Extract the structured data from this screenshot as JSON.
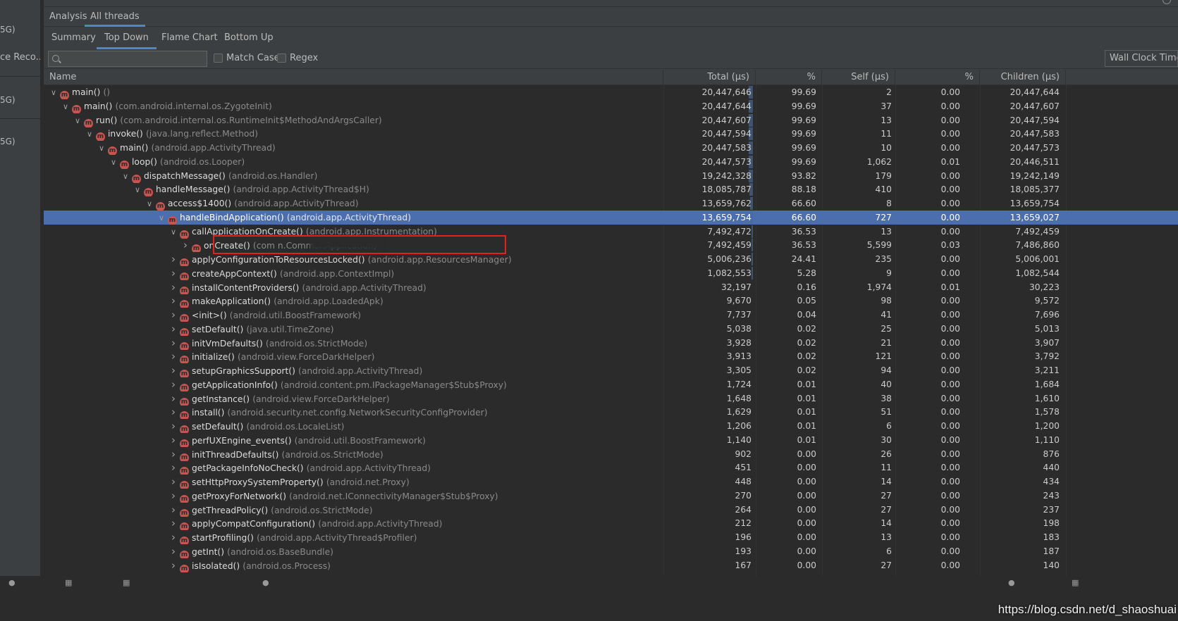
{
  "left_panel": {
    "items": [
      "5G)",
      "ce Reco...",
      "5G)",
      "5G)"
    ]
  },
  "analysis_tabs": [
    "Analysis",
    "All threads"
  ],
  "view_tabs": [
    "Summary",
    "Top Down",
    "Flame Chart",
    "Bottom Up"
  ],
  "search": {
    "placeholder": "",
    "value": ""
  },
  "filters": {
    "match_case": "Match Case",
    "regex": "Regex"
  },
  "clock_select": "Wall Clock Time",
  "columns": [
    "Name",
    "Total (μs)",
    "%",
    "Self (μs)",
    "%",
    "Children (μs)"
  ],
  "rows": [
    {
      "name": "main()",
      "cls": "()",
      "depth": 0,
      "expand": "down",
      "total": "20,447,646",
      "tpct": "99.69",
      "self": "2",
      "spct": "0.00",
      "children": "20,447,644",
      "bar": 0.997
    },
    {
      "name": "main()",
      "cls": "(com.android.internal.os.ZygoteInit)",
      "depth": 1,
      "expand": "down",
      "total": "20,447,644",
      "tpct": "99.69",
      "self": "37",
      "spct": "0.00",
      "children": "20,447,607",
      "bar": 0.997
    },
    {
      "name": "run()",
      "cls": "(com.android.internal.os.RuntimeInit$MethodAndArgsCaller)",
      "depth": 2,
      "expand": "down",
      "total": "20,447,607",
      "tpct": "99.69",
      "self": "13",
      "spct": "0.00",
      "children": "20,447,594",
      "bar": 0.997
    },
    {
      "name": "invoke()",
      "cls": "(java.lang.reflect.Method)",
      "depth": 3,
      "expand": "down",
      "total": "20,447,594",
      "tpct": "99.69",
      "self": "11",
      "spct": "0.00",
      "children": "20,447,583",
      "bar": 0.997
    },
    {
      "name": "main()",
      "cls": "(android.app.ActivityThread)",
      "depth": 4,
      "expand": "down",
      "total": "20,447,583",
      "tpct": "99.69",
      "self": "10",
      "spct": "0.00",
      "children": "20,447,573",
      "bar": 0.997
    },
    {
      "name": "loop()",
      "cls": "(android.os.Looper)",
      "depth": 5,
      "expand": "down",
      "total": "20,447,573",
      "tpct": "99.69",
      "self": "1,062",
      "spct": "0.01",
      "children": "20,446,511",
      "bar": 0.997
    },
    {
      "name": "dispatchMessage()",
      "cls": "(android.os.Handler)",
      "depth": 6,
      "expand": "down",
      "total": "19,242,328",
      "tpct": "93.82",
      "self": "179",
      "spct": "0.00",
      "children": "19,242,149",
      "bar": 0.938
    },
    {
      "name": "handleMessage()",
      "cls": "(android.app.ActivityThread$H)",
      "depth": 7,
      "expand": "down",
      "total": "18,085,787",
      "tpct": "88.18",
      "self": "410",
      "spct": "0.00",
      "children": "18,085,377",
      "bar": 0.882
    },
    {
      "name": "access$1400()",
      "cls": "(android.app.ActivityThread)",
      "depth": 8,
      "expand": "down",
      "total": "13,659,762",
      "tpct": "66.60",
      "self": "8",
      "spct": "0.00",
      "children": "13,659,754",
      "bar": 0.666
    },
    {
      "name": "handleBindApplication()",
      "cls": "(android.app.ActivityThread)",
      "depth": 9,
      "expand": "down",
      "total": "13,659,754",
      "tpct": "66.60",
      "self": "727",
      "spct": "0.00",
      "children": "13,659,027",
      "bar": 0.666,
      "selected": true
    },
    {
      "name": "callApplicationOnCreate()",
      "cls": "(android.app.Instrumentation)",
      "depth": 10,
      "expand": "down",
      "total": "7,492,472",
      "tpct": "36.53",
      "self": "13",
      "spct": "0.00",
      "children": "7,492,459",
      "bar": 0.365
    },
    {
      "name": "onCreate()",
      "cls": "(com                    n.CommonApplication)",
      "depth": 11,
      "expand": "right",
      "total": "7,492,459",
      "tpct": "36.53",
      "self": "5,599",
      "spct": "0.03",
      "children": "7,486,860",
      "bar": 0.365
    },
    {
      "name": "applyConfigurationToResourcesLocked()",
      "cls": "(android.app.ResourcesManager)",
      "depth": 10,
      "expand": "right",
      "total": "5,006,236",
      "tpct": "24.41",
      "self": "235",
      "spct": "0.00",
      "children": "5,006,001",
      "bar": 0.244
    },
    {
      "name": "createAppContext()",
      "cls": "(android.app.ContextImpl)",
      "depth": 10,
      "expand": "right",
      "total": "1,082,553",
      "tpct": "5.28",
      "self": "9",
      "spct": "0.00",
      "children": "1,082,544",
      "bar": 0.053
    },
    {
      "name": "installContentProviders()",
      "cls": "(android.app.ActivityThread)",
      "depth": 10,
      "expand": "right",
      "total": "32,197",
      "tpct": "0.16",
      "self": "1,974",
      "spct": "0.01",
      "children": "30,223",
      "bar": 0
    },
    {
      "name": "makeApplication()",
      "cls": "(android.app.LoadedApk)",
      "depth": 10,
      "expand": "right",
      "total": "9,670",
      "tpct": "0.05",
      "self": "98",
      "spct": "0.00",
      "children": "9,572",
      "bar": 0
    },
    {
      "name": "<init>()",
      "cls": "(android.util.BoostFramework)",
      "depth": 10,
      "expand": "right",
      "total": "7,737",
      "tpct": "0.04",
      "self": "41",
      "spct": "0.00",
      "children": "7,696",
      "bar": 0
    },
    {
      "name": "setDefault()",
      "cls": "(java.util.TimeZone)",
      "depth": 10,
      "expand": "right",
      "total": "5,038",
      "tpct": "0.02",
      "self": "25",
      "spct": "0.00",
      "children": "5,013",
      "bar": 0
    },
    {
      "name": "initVmDefaults()",
      "cls": "(android.os.StrictMode)",
      "depth": 10,
      "expand": "right",
      "total": "3,928",
      "tpct": "0.02",
      "self": "21",
      "spct": "0.00",
      "children": "3,907",
      "bar": 0
    },
    {
      "name": "initialize()",
      "cls": "(android.view.ForceDarkHelper)",
      "depth": 10,
      "expand": "right",
      "total": "3,913",
      "tpct": "0.02",
      "self": "121",
      "spct": "0.00",
      "children": "3,792",
      "bar": 0
    },
    {
      "name": "setupGraphicsSupport()",
      "cls": "(android.app.ActivityThread)",
      "depth": 10,
      "expand": "right",
      "total": "3,305",
      "tpct": "0.02",
      "self": "94",
      "spct": "0.00",
      "children": "3,211",
      "bar": 0
    },
    {
      "name": "getApplicationInfo()",
      "cls": "(android.content.pm.IPackageManager$Stub$Proxy)",
      "depth": 10,
      "expand": "right",
      "total": "1,724",
      "tpct": "0.01",
      "self": "40",
      "spct": "0.00",
      "children": "1,684",
      "bar": 0
    },
    {
      "name": "getInstance()",
      "cls": "(android.view.ForceDarkHelper)",
      "depth": 10,
      "expand": "right",
      "total": "1,648",
      "tpct": "0.01",
      "self": "38",
      "spct": "0.00",
      "children": "1,610",
      "bar": 0
    },
    {
      "name": "install()",
      "cls": "(android.security.net.config.NetworkSecurityConfigProvider)",
      "depth": 10,
      "expand": "right",
      "total": "1,629",
      "tpct": "0.01",
      "self": "51",
      "spct": "0.00",
      "children": "1,578",
      "bar": 0
    },
    {
      "name": "setDefault()",
      "cls": "(android.os.LocaleList)",
      "depth": 10,
      "expand": "right",
      "total": "1,206",
      "tpct": "0.01",
      "self": "6",
      "spct": "0.00",
      "children": "1,200",
      "bar": 0
    },
    {
      "name": "perfUXEngine_events()",
      "cls": "(android.util.BoostFramework)",
      "depth": 10,
      "expand": "right",
      "total": "1,140",
      "tpct": "0.01",
      "self": "30",
      "spct": "0.00",
      "children": "1,110",
      "bar": 0
    },
    {
      "name": "initThreadDefaults()",
      "cls": "(android.os.StrictMode)",
      "depth": 10,
      "expand": "right",
      "total": "902",
      "tpct": "0.00",
      "self": "26",
      "spct": "0.00",
      "children": "876",
      "bar": 0
    },
    {
      "name": "getPackageInfoNoCheck()",
      "cls": "(android.app.ActivityThread)",
      "depth": 10,
      "expand": "right",
      "total": "451",
      "tpct": "0.00",
      "self": "11",
      "spct": "0.00",
      "children": "440",
      "bar": 0
    },
    {
      "name": "setHttpProxySystemProperty()",
      "cls": "(android.net.Proxy)",
      "depth": 10,
      "expand": "right",
      "total": "448",
      "tpct": "0.00",
      "self": "14",
      "spct": "0.00",
      "children": "434",
      "bar": 0
    },
    {
      "name": "getProxyForNetwork()",
      "cls": "(android.net.IConnectivityManager$Stub$Proxy)",
      "depth": 10,
      "expand": "right",
      "total": "270",
      "tpct": "0.00",
      "self": "27",
      "spct": "0.00",
      "children": "243",
      "bar": 0
    },
    {
      "name": "getThreadPolicy()",
      "cls": "(android.os.StrictMode)",
      "depth": 10,
      "expand": "right",
      "total": "264",
      "tpct": "0.00",
      "self": "27",
      "spct": "0.00",
      "children": "237",
      "bar": 0
    },
    {
      "name": "applyCompatConfiguration()",
      "cls": "(android.app.ActivityThread)",
      "depth": 10,
      "expand": "right",
      "total": "212",
      "tpct": "0.00",
      "self": "14",
      "spct": "0.00",
      "children": "198",
      "bar": 0
    },
    {
      "name": "startProfiling()",
      "cls": "(android.app.ActivityThread$Profiler)",
      "depth": 10,
      "expand": "right",
      "total": "196",
      "tpct": "0.00",
      "self": "13",
      "spct": "0.00",
      "children": "183",
      "bar": 0
    },
    {
      "name": "getInt()",
      "cls": "(android.os.BaseBundle)",
      "depth": 10,
      "expand": "right",
      "total": "193",
      "tpct": "0.00",
      "self": "6",
      "spct": "0.00",
      "children": "187",
      "bar": 0
    },
    {
      "name": "isIsolated()",
      "cls": "(android.os.Process)",
      "depth": 10,
      "expand": "right",
      "total": "167",
      "tpct": "0.00",
      "self": "27",
      "spct": "0.00",
      "children": "140",
      "bar": 0
    }
  ],
  "watermark": "https://blog.csdn.net/d_shaoshuai",
  "colors": {
    "accent": "#4a88c7",
    "selection": "#4b6eaf",
    "method_icon": "#c75450",
    "highlight_box": "#e8201c"
  }
}
